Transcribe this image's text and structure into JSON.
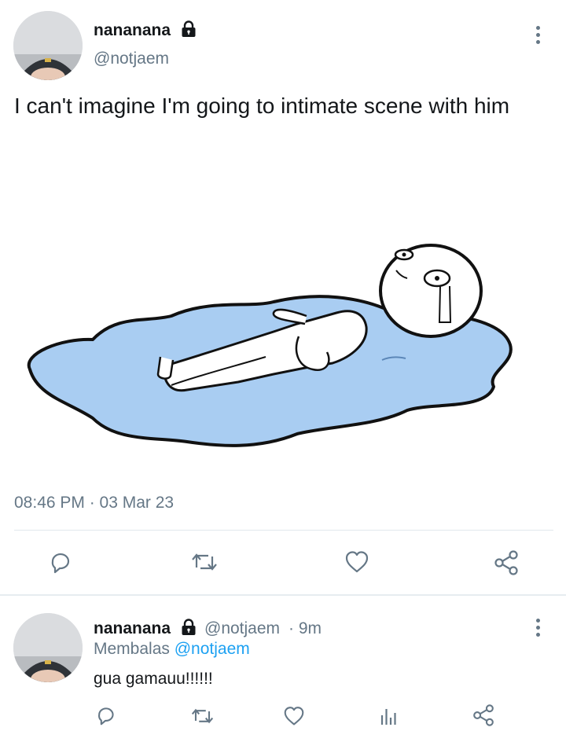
{
  "main_tweet": {
    "display_name": "nananana",
    "handle": "@notjaem",
    "text": "I can't imagine I'm going to intimate scene with him",
    "timestamp": "08:46 PM · 03 Mar 23",
    "icons": {
      "lock": "lock-icon",
      "more": "more-vertical-icon",
      "reply": "reply-icon",
      "retweet": "retweet-icon",
      "like": "heart-icon",
      "share": "share-icon"
    }
  },
  "reply_tweet": {
    "display_name": "nananana",
    "handle": "@notjaem",
    "time": "· 9m",
    "replying_prefix": "Membalas",
    "replying_to": "@notjaem",
    "text": "gua gamauu!!!!!!",
    "icons": {
      "lock": "lock-icon",
      "more": "more-vertical-icon",
      "reply": "reply-icon",
      "retweet": "retweet-icon",
      "like": "heart-icon",
      "analytics": "analytics-icon",
      "share": "share-icon"
    }
  },
  "colors": {
    "text": "#14171a",
    "muted": "#657786",
    "link": "#1da1f2",
    "divider": "#e1e8ed",
    "puddle": "#a9cdf2"
  }
}
